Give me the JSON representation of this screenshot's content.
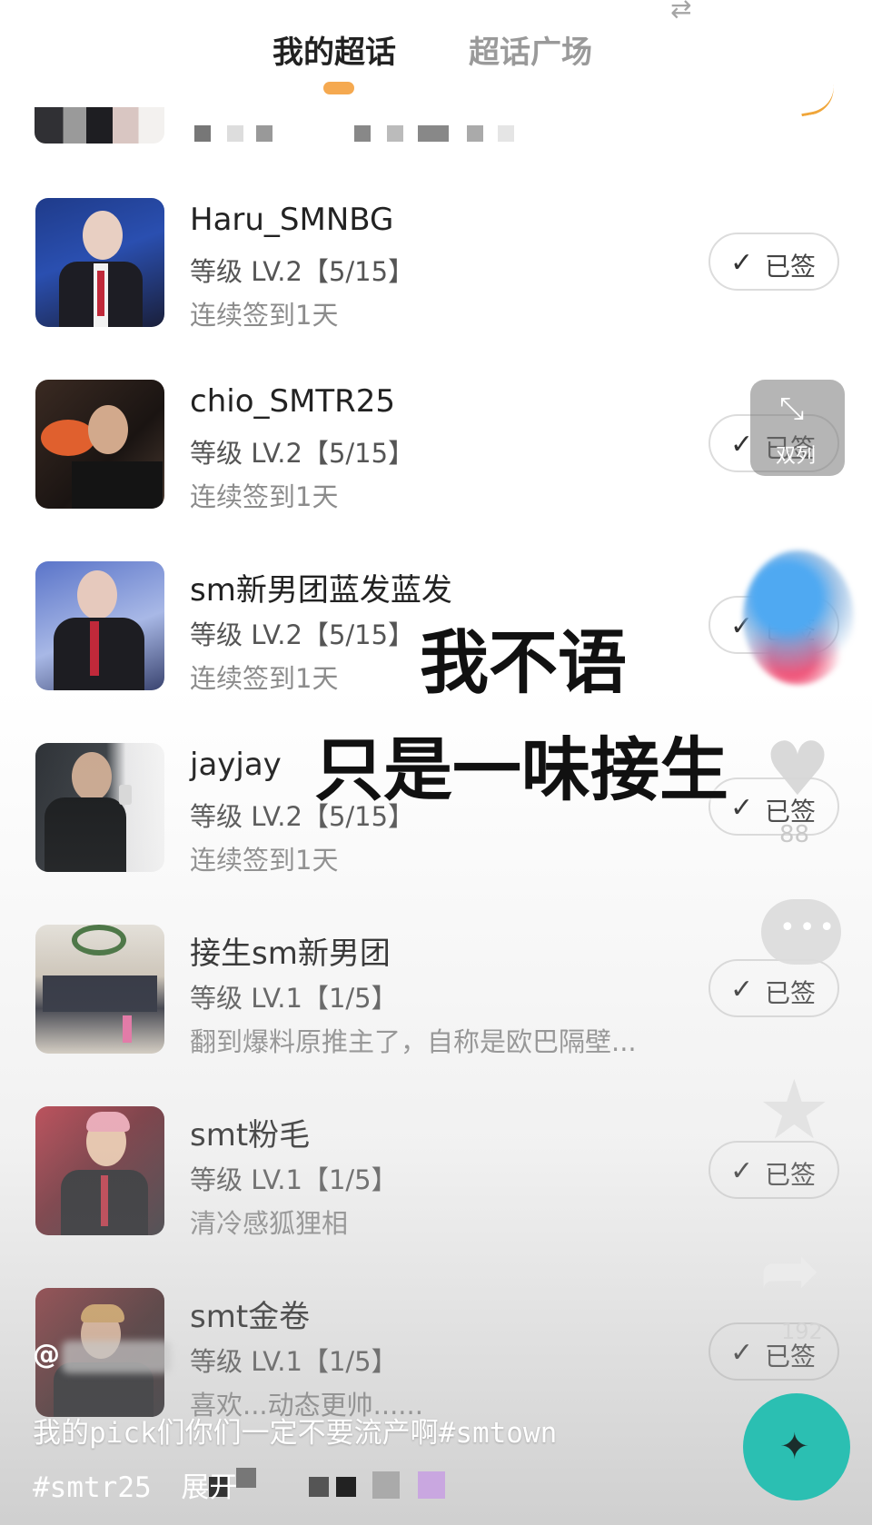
{
  "header": {
    "tabs": [
      {
        "label": "我的超话",
        "active": true
      },
      {
        "label": "超话广场",
        "active": false
      }
    ]
  },
  "topics": [
    {
      "name": "Haru_SMNBG",
      "level": "等级 LV.2【5/15】",
      "desc": "连续签到1天",
      "button": "已签"
    },
    {
      "name": "chio_SMTR25",
      "level": "等级 LV.2【5/15】",
      "desc": "连续签到1天",
      "button": "已签"
    },
    {
      "name": "sm新男团蓝发蓝发",
      "level": "等级 LV.2【5/15】",
      "desc": "连续签到1天",
      "button": "已签"
    },
    {
      "name": "jayjay",
      "level": "等级 LV.2【5/15】",
      "desc": "连续签到1天",
      "button": "已签"
    },
    {
      "name": "接生sm新男团",
      "level": "等级 LV.1【1/5】",
      "desc": "翻到爆料原推主了，自称是欧巴隔壁...",
      "button": "已签"
    },
    {
      "name": "smt粉毛",
      "level": "等级 LV.1【1/5】",
      "desc": "清冷感狐狸相",
      "button": "已签"
    },
    {
      "name": "smt金卷",
      "level": "等级 LV.1【1/5】",
      "desc": "喜欢...动态更帅......",
      "button": "已签"
    }
  ],
  "overlay": {
    "line1": "我不语",
    "line2": "只是一味接生"
  },
  "video_controls": {
    "dual_column_label": "双列",
    "like_count": "88",
    "share_count": "192"
  },
  "caption": {
    "author_prefix": "@",
    "text": "我的pick们你们一定不要流产啊#smtown",
    "hashtag": "#smtr25",
    "expand": "展开"
  }
}
